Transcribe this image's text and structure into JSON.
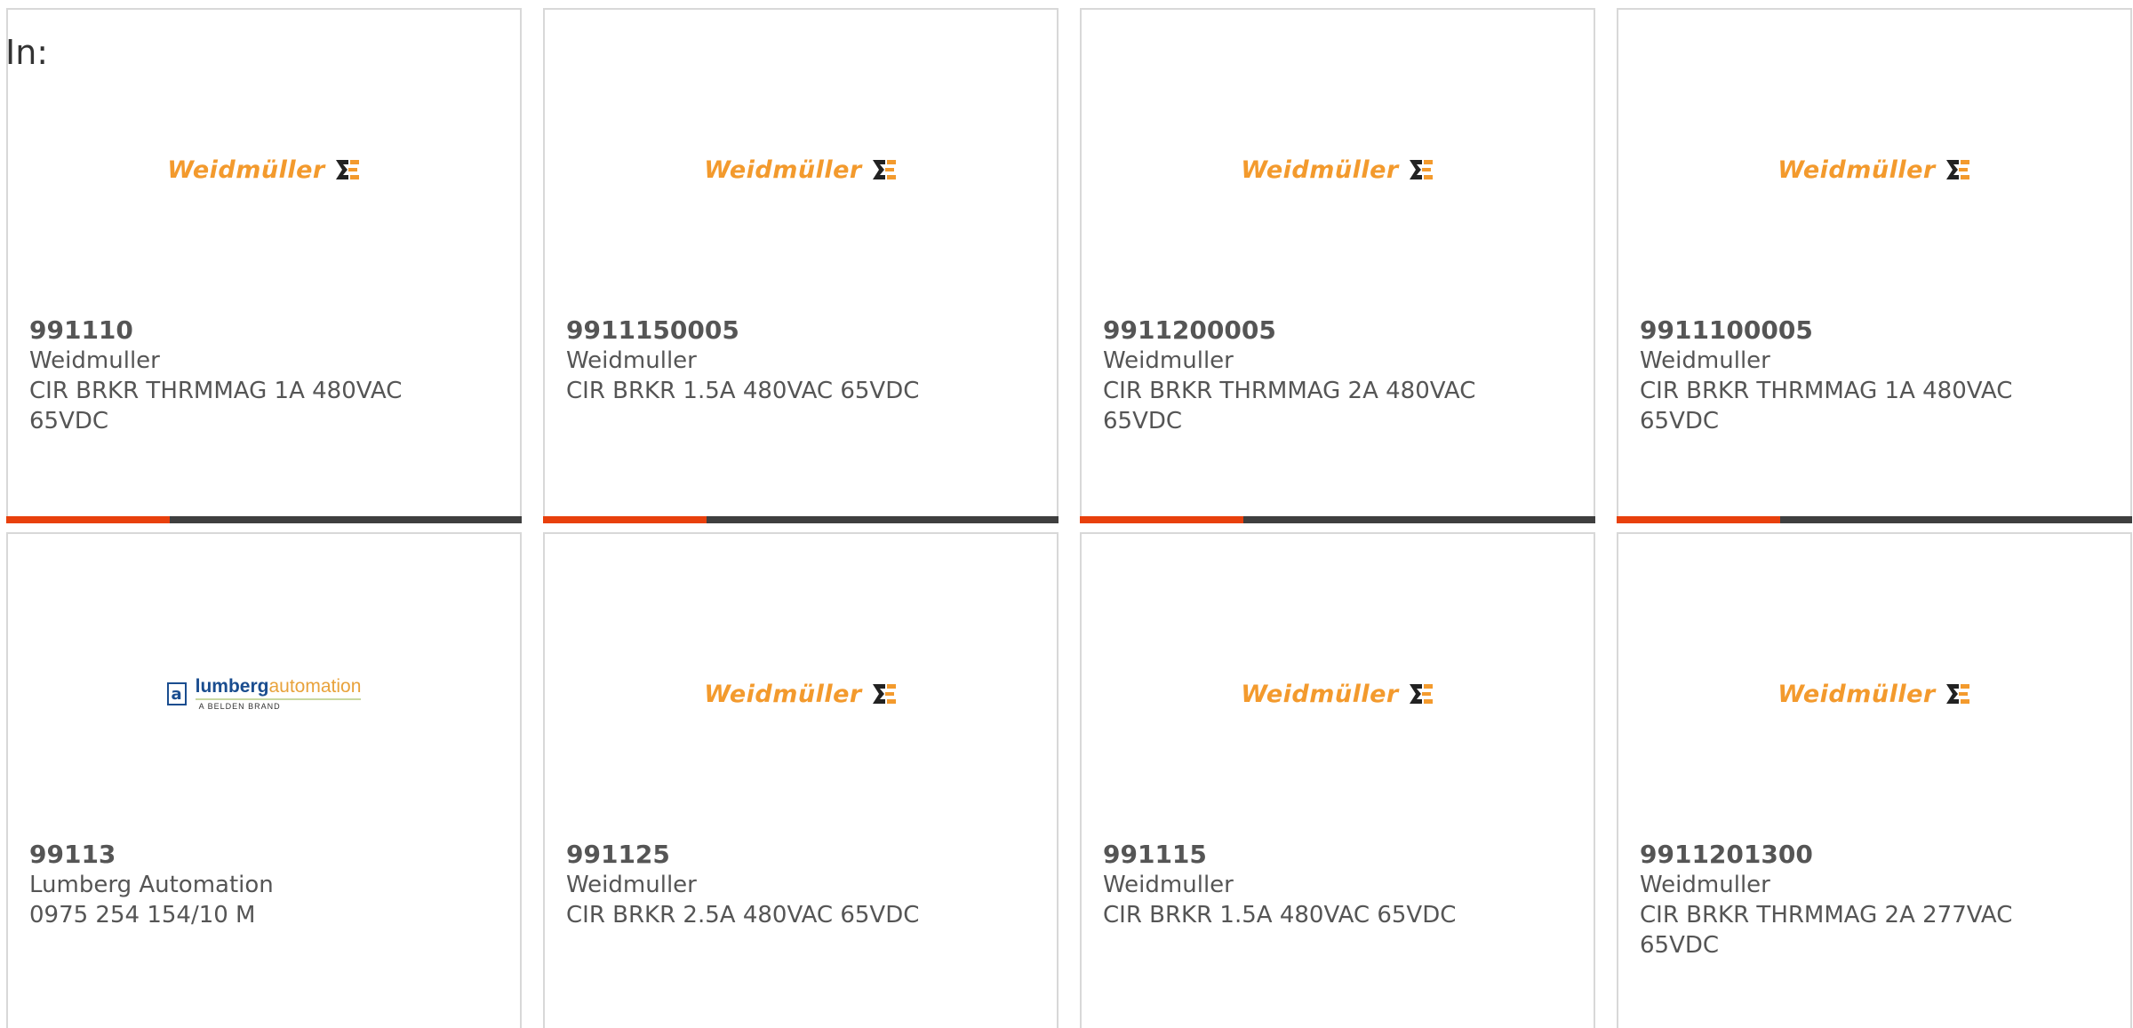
{
  "header": {
    "in_label": "In:"
  },
  "colors": {
    "accent": "#e8400c",
    "bar_dark": "#3f3f3f",
    "weidmuller_orange": "#f39a2d",
    "weidmuller_dark": "#222222",
    "lumberg_blue": "#1a4d8f",
    "lumberg_orange": "#e8a23b"
  },
  "products": [
    {
      "part": "991110",
      "brand": "Weidmuller",
      "description": "CIR BRKR THRMMAG 1A 480VAC 65VDC",
      "logo": "weidmuller",
      "logo_text": "Weidmüller"
    },
    {
      "part": "9911150005",
      "brand": "Weidmuller",
      "description": "CIR BRKR 1.5A 480VAC 65VDC",
      "logo": "weidmuller",
      "logo_text": "Weidmüller"
    },
    {
      "part": "9911200005",
      "brand": "Weidmuller",
      "description": "CIR BRKR THRMMAG 2A 480VAC 65VDC",
      "logo": "weidmuller",
      "logo_text": "Weidmüller"
    },
    {
      "part": "9911100005",
      "brand": "Weidmuller",
      "description": "CIR BRKR THRMMAG 1A 480VAC 65VDC",
      "logo": "weidmuller",
      "logo_text": "Weidmüller"
    },
    {
      "part": "99113",
      "brand": "Lumberg Automation",
      "description": "0975 254 154/10 M",
      "logo": "lumberg",
      "logo_text_a": "lumberg",
      "logo_text_b": "automation",
      "logo_sub": "A BELDEN BRAND",
      "logo_box": "a"
    },
    {
      "part": "991125",
      "brand": "Weidmuller",
      "description": "CIR BRKR 2.5A 480VAC 65VDC",
      "logo": "weidmuller",
      "logo_text": "Weidmüller"
    },
    {
      "part": "991115",
      "brand": "Weidmuller",
      "description": "CIR BRKR 1.5A 480VAC 65VDC",
      "logo": "weidmuller",
      "logo_text": "Weidmüller"
    },
    {
      "part": "9911201300",
      "brand": "Weidmuller",
      "description": "CIR BRKR THRMMAG 2A 277VAC 65VDC",
      "logo": "weidmuller",
      "logo_text": "Weidmüller"
    }
  ]
}
